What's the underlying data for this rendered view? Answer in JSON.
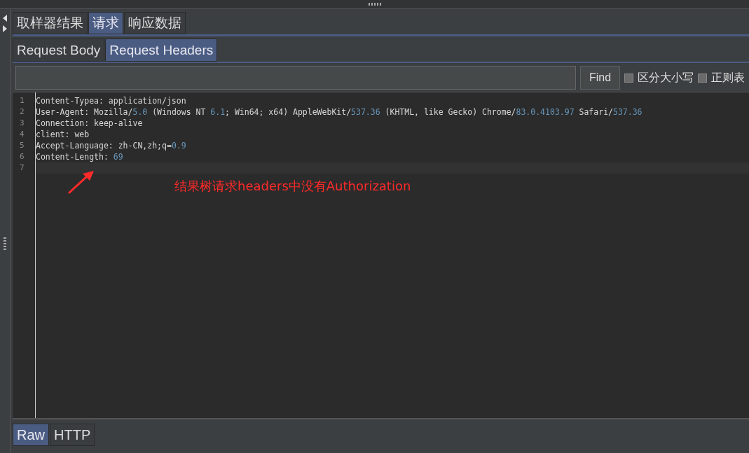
{
  "result_tabs": [
    {
      "label": "取样器结果",
      "selected": false
    },
    {
      "label": "请求",
      "selected": true
    },
    {
      "label": "响应数据",
      "selected": false
    }
  ],
  "request_tabs": [
    {
      "label": "Request Body",
      "selected": false
    },
    {
      "label": "Request Headers",
      "selected": true
    }
  ],
  "search": {
    "button": "Find",
    "options": [
      {
        "label": "区分大小写",
        "checked": false
      },
      {
        "label": "正则表",
        "checked": false
      }
    ]
  },
  "editor": {
    "lines": [
      {
        "number": "1",
        "segments": [
          {
            "kind": "text",
            "text": "Content-Typea: application/json"
          }
        ]
      },
      {
        "number": "2",
        "segments": [
          {
            "kind": "text",
            "text": "User-Agent: Mozilla/"
          },
          {
            "kind": "number",
            "text": "5.0"
          },
          {
            "kind": "text",
            "text": " (Windows NT "
          },
          {
            "kind": "number",
            "text": "6.1"
          },
          {
            "kind": "text",
            "text": "; Win64; x64) AppleWebKit/"
          },
          {
            "kind": "number",
            "text": "537.36"
          },
          {
            "kind": "text",
            "text": " (KHTML, like Gecko) Chrome/"
          },
          {
            "kind": "number",
            "text": "83.0.4103.97"
          },
          {
            "kind": "text",
            "text": " Safari/"
          },
          {
            "kind": "number",
            "text": "537.36"
          }
        ]
      },
      {
        "number": "3",
        "segments": [
          {
            "kind": "text",
            "text": "Connection: keep-alive"
          }
        ]
      },
      {
        "number": "4",
        "segments": [
          {
            "kind": "text",
            "text": "client: web"
          }
        ]
      },
      {
        "number": "5",
        "segments": [
          {
            "kind": "text",
            "text": "Accept-Language: zh-CN,zh;q="
          },
          {
            "kind": "number",
            "text": "0.9"
          }
        ]
      },
      {
        "number": "6",
        "segments": [
          {
            "kind": "text",
            "text": "Content-Length: "
          },
          {
            "kind": "number",
            "text": "69"
          }
        ]
      },
      {
        "number": "7"
      }
    ],
    "annotation": "结果树请求headers中没有Authorization"
  },
  "view_tabs": [
    {
      "label": "Raw",
      "selected": true
    },
    {
      "label": "HTTP",
      "selected": false
    }
  ]
}
